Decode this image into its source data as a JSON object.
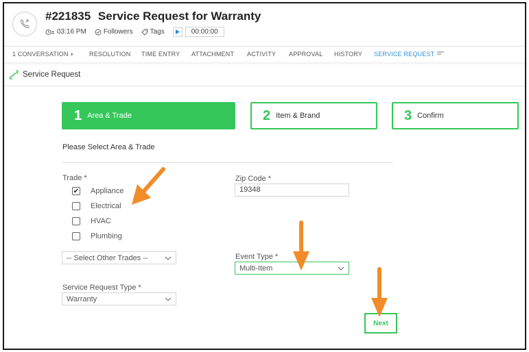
{
  "ticket": {
    "number": "#221835",
    "title": "Service Request for Warranty",
    "time": "03:16 PM",
    "followers_label": "Followers",
    "tags_label": "Tags",
    "timer": "00:00:00"
  },
  "tabs": [
    {
      "label": "1 CONVERSATION"
    },
    {
      "label": "RESOLUTION"
    },
    {
      "label": "TIME ENTRY"
    },
    {
      "label": "ATTACHMENT"
    },
    {
      "label": "ACTIVITY"
    },
    {
      "label": "APPROVAL"
    },
    {
      "label": "HISTORY"
    },
    {
      "label": "SERVICE REQUEST"
    }
  ],
  "active_tab": "SERVICE REQUEST",
  "section": {
    "title": "Service Request"
  },
  "steps": [
    {
      "number": "1",
      "label": "Area & Trade",
      "active": true
    },
    {
      "number": "2",
      "label": "Item & Brand",
      "active": false
    },
    {
      "number": "3",
      "label": "Confirm",
      "active": false
    }
  ],
  "form": {
    "heading": "Please Select Area & Trade",
    "trade_label": "Trade *",
    "trades": [
      {
        "label": "Appliance",
        "checked": true
      },
      {
        "label": "Electrical",
        "checked": false
      },
      {
        "label": "HVAC",
        "checked": false
      },
      {
        "label": "Plumbing",
        "checked": false
      }
    ],
    "other_trades_placeholder": "-- Select Other Trades --",
    "zip_label": "Zip Code *",
    "zip_value": "19348",
    "event_type_label": "Event Type *",
    "event_type_value": "Multi-Item",
    "sr_type_label": "Service Request Type *",
    "sr_type_value": "Warranty",
    "next_label": "Next"
  },
  "colors": {
    "accent_green": "#35c759",
    "active_tab_blue": "#2a8fd8",
    "annotation_orange": "#f28c28"
  },
  "icons": [
    "phone-icon",
    "clock-icon",
    "followers-icon",
    "tag-icon",
    "play-icon",
    "menu-icon",
    "service-request-icon",
    "chevron-down-icon",
    "checkmark-icon"
  ]
}
